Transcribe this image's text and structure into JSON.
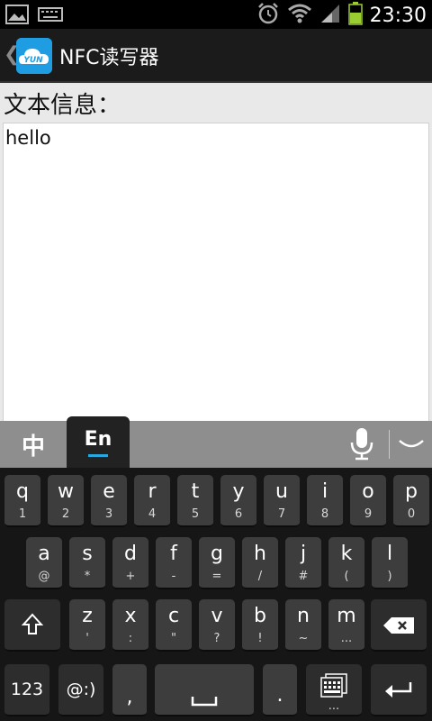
{
  "status_bar": {
    "time": "23:30",
    "icons": [
      "image-icon",
      "keyboard-icon",
      "alarm-icon",
      "wifi-icon",
      "signal-icon",
      "battery-icon"
    ]
  },
  "action_bar": {
    "title": "NFC读写器",
    "logo_text": "YUN"
  },
  "content": {
    "label": "文本信息：",
    "text_value": "hello"
  },
  "keyboard_toolbar": {
    "lang_zh": "中",
    "lang_en": "En",
    "accent": "#29a8e0"
  },
  "keyboard": {
    "row1": [
      {
        "main": "q",
        "sub": "1"
      },
      {
        "main": "w",
        "sub": "2"
      },
      {
        "main": "e",
        "sub": "3"
      },
      {
        "main": "r",
        "sub": "4"
      },
      {
        "main": "t",
        "sub": "5"
      },
      {
        "main": "y",
        "sub": "6"
      },
      {
        "main": "u",
        "sub": "7"
      },
      {
        "main": "i",
        "sub": "8"
      },
      {
        "main": "o",
        "sub": "9"
      },
      {
        "main": "p",
        "sub": "0"
      }
    ],
    "row2": [
      {
        "main": "a",
        "sub": "@"
      },
      {
        "main": "s",
        "sub": "*"
      },
      {
        "main": "d",
        "sub": "+"
      },
      {
        "main": "f",
        "sub": "-"
      },
      {
        "main": "g",
        "sub": "="
      },
      {
        "main": "h",
        "sub": "/"
      },
      {
        "main": "j",
        "sub": "#"
      },
      {
        "main": "k",
        "sub": "("
      },
      {
        "main": "l",
        "sub": ")"
      }
    ],
    "row3": [
      {
        "main": "z",
        "sub": "'"
      },
      {
        "main": "x",
        "sub": ":"
      },
      {
        "main": "c",
        "sub": "\""
      },
      {
        "main": "v",
        "sub": "?"
      },
      {
        "main": "b",
        "sub": "!"
      },
      {
        "main": "n",
        "sub": "~"
      },
      {
        "main": "m",
        "sub": "..."
      }
    ],
    "key_123": "123",
    "key_emoticon": "@:)",
    "key_comma": ",",
    "key_period": ".",
    "key_period_sub": ".",
    "key_more_sub": "..."
  }
}
